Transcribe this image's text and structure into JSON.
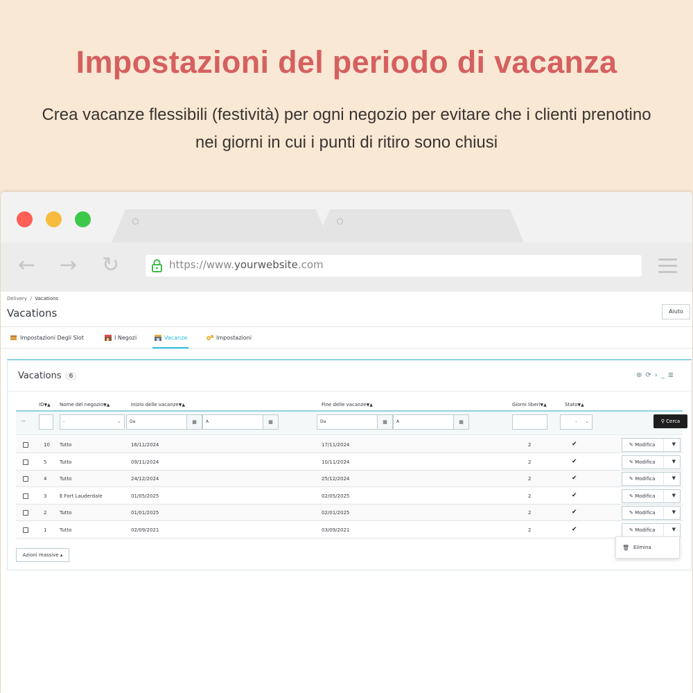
{
  "hero": {
    "title": "Impostazioni del periodo di vacanza",
    "subtitle_line1": "Crea vacanze flessibili (festività) per ogni negozio per evitare che i clienti prenotino",
    "subtitle_line2": "nei giorni in cui i punti di ritiro sono chiusi"
  },
  "browser": {
    "url_prefix": "https://www.",
    "url_domain": "yourwebsite",
    "url_suffix": ".com"
  },
  "admin": {
    "breadcrumb": {
      "parent": "Delivery",
      "separator": "/",
      "current": "Vacations"
    },
    "page_title": "Vacations",
    "help_label": "Aiuto",
    "tabs": [
      {
        "label": "Impostazioni Degli Slot",
        "icon": "box-icon"
      },
      {
        "label": "I Negozi",
        "icon": "store-icon"
      },
      {
        "label": "Vacanze",
        "icon": "beach-icon",
        "active": true
      },
      {
        "label": "Impostazioni",
        "icon": "gears-icon"
      }
    ],
    "panel": {
      "title": "Vacations",
      "count": "6",
      "columns": {
        "id": "ID",
        "store": "Nome del negozio",
        "start": "Inizio delle vacanze",
        "end": "Fine delle vacanze",
        "days": "Giorni liberi",
        "status": "Stato"
      },
      "filters": {
        "dash": "--",
        "store_select": "-",
        "start_from": "Da",
        "start_to": "A",
        "end_from": "Da",
        "end_to": "A",
        "status_select": "-",
        "search_label": "Cerca"
      },
      "rows": [
        {
          "id": "10",
          "store": "Tutto",
          "start": "16/11/2024",
          "end": "17/11/2024",
          "days": "2",
          "edit": "Modifica"
        },
        {
          "id": "5",
          "store": "Tutto",
          "start": "09/11/2024",
          "end": "10/11/2024",
          "days": "2",
          "edit": "Modifica"
        },
        {
          "id": "4",
          "store": "Tutto",
          "start": "24/12/2024",
          "end": "25/12/2024",
          "days": "2",
          "edit": "Modifica"
        },
        {
          "id": "3",
          "store": "E Fort Lauderdale",
          "start": "01/05/2025",
          "end": "02/05/2025",
          "days": "2",
          "edit": "Modifica"
        },
        {
          "id": "2",
          "store": "Tutto",
          "start": "01/01/2025",
          "end": "02/01/2025",
          "days": "2",
          "edit": "Modifica"
        },
        {
          "id": "1",
          "store": "Tutto",
          "start": "02/09/2021",
          "end": "03/09/2021",
          "days": "2",
          "edit": "Modifica"
        }
      ],
      "bulk_label": "Azioni massive",
      "dropdown_delete": "Elimina"
    }
  },
  "colors": {
    "title": "#d5605f",
    "background": "#f8e8d4",
    "accent": "#25b9d7"
  }
}
